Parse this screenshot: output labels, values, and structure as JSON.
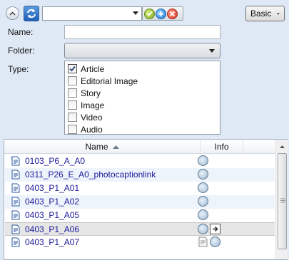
{
  "toolbar": {
    "collapse_icon": "chevron-up-icon",
    "refresh_icon": "refresh-icon",
    "query_value": "",
    "accept_icon": "check-icon",
    "add_icon": "plus-icon",
    "remove_icon": "close-icon",
    "mode_label": "Basic"
  },
  "form": {
    "name_label": "Name:",
    "name_value": "",
    "folder_label": "Folder:",
    "folder_value": "",
    "type_label": "Type:",
    "types": [
      {
        "label": "Article",
        "checked": true
      },
      {
        "label": "Editorial Image",
        "checked": false
      },
      {
        "label": "Story",
        "checked": false
      },
      {
        "label": "Image",
        "checked": false
      },
      {
        "label": "Video",
        "checked": false
      },
      {
        "label": "Audio",
        "checked": false
      }
    ]
  },
  "results": {
    "columns": {
      "name": "Name",
      "info": "Info"
    },
    "rows": [
      {
        "name": "0103_P6_A_A0",
        "selected": false
      },
      {
        "name": "0311_P26_E_A0_photocaptionlink",
        "selected": false
      },
      {
        "name": "0403_P1_A01",
        "selected": false
      },
      {
        "name": "0403_P1_A02",
        "selected": false
      },
      {
        "name": "0403_P1_A05",
        "selected": false
      },
      {
        "name": "0403_P1_A06",
        "selected": true
      },
      {
        "name": "0403_P1_A07",
        "selected": false
      }
    ]
  },
  "colors": {
    "panel_bg": "#dfe9f5",
    "link_text": "#1a1a9a",
    "selected_row": "#e6e6e6",
    "alt_row": "#eef4fb"
  }
}
